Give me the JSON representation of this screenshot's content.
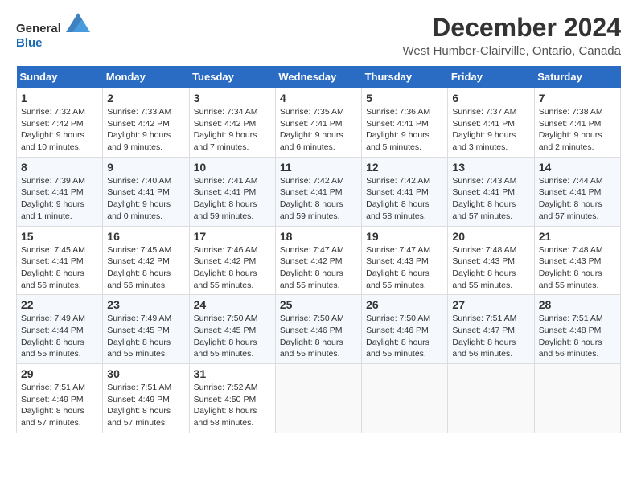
{
  "logo": {
    "general": "General",
    "blue": "Blue"
  },
  "title": "December 2024",
  "subtitle": "West Humber-Clairville, Ontario, Canada",
  "days_of_week": [
    "Sunday",
    "Monday",
    "Tuesday",
    "Wednesday",
    "Thursday",
    "Friday",
    "Saturday"
  ],
  "weeks": [
    [
      {
        "day": 1,
        "sunrise": "7:32 AM",
        "sunset": "4:42 PM",
        "daylight": "9 hours and 10 minutes."
      },
      {
        "day": 2,
        "sunrise": "7:33 AM",
        "sunset": "4:42 PM",
        "daylight": "9 hours and 9 minutes."
      },
      {
        "day": 3,
        "sunrise": "7:34 AM",
        "sunset": "4:42 PM",
        "daylight": "9 hours and 7 minutes."
      },
      {
        "day": 4,
        "sunrise": "7:35 AM",
        "sunset": "4:41 PM",
        "daylight": "9 hours and 6 minutes."
      },
      {
        "day": 5,
        "sunrise": "7:36 AM",
        "sunset": "4:41 PM",
        "daylight": "9 hours and 5 minutes."
      },
      {
        "day": 6,
        "sunrise": "7:37 AM",
        "sunset": "4:41 PM",
        "daylight": "9 hours and 3 minutes."
      },
      {
        "day": 7,
        "sunrise": "7:38 AM",
        "sunset": "4:41 PM",
        "daylight": "9 hours and 2 minutes."
      }
    ],
    [
      {
        "day": 8,
        "sunrise": "7:39 AM",
        "sunset": "4:41 PM",
        "daylight": "9 hours and 1 minute."
      },
      {
        "day": 9,
        "sunrise": "7:40 AM",
        "sunset": "4:41 PM",
        "daylight": "9 hours and 0 minutes."
      },
      {
        "day": 10,
        "sunrise": "7:41 AM",
        "sunset": "4:41 PM",
        "daylight": "8 hours and 59 minutes."
      },
      {
        "day": 11,
        "sunrise": "7:42 AM",
        "sunset": "4:41 PM",
        "daylight": "8 hours and 59 minutes."
      },
      {
        "day": 12,
        "sunrise": "7:42 AM",
        "sunset": "4:41 PM",
        "daylight": "8 hours and 58 minutes."
      },
      {
        "day": 13,
        "sunrise": "7:43 AM",
        "sunset": "4:41 PM",
        "daylight": "8 hours and 57 minutes."
      },
      {
        "day": 14,
        "sunrise": "7:44 AM",
        "sunset": "4:41 PM",
        "daylight": "8 hours and 57 minutes."
      }
    ],
    [
      {
        "day": 15,
        "sunrise": "7:45 AM",
        "sunset": "4:41 PM",
        "daylight": "8 hours and 56 minutes."
      },
      {
        "day": 16,
        "sunrise": "7:45 AM",
        "sunset": "4:42 PM",
        "daylight": "8 hours and 56 minutes."
      },
      {
        "day": 17,
        "sunrise": "7:46 AM",
        "sunset": "4:42 PM",
        "daylight": "8 hours and 55 minutes."
      },
      {
        "day": 18,
        "sunrise": "7:47 AM",
        "sunset": "4:42 PM",
        "daylight": "8 hours and 55 minutes."
      },
      {
        "day": 19,
        "sunrise": "7:47 AM",
        "sunset": "4:43 PM",
        "daylight": "8 hours and 55 minutes."
      },
      {
        "day": 20,
        "sunrise": "7:48 AM",
        "sunset": "4:43 PM",
        "daylight": "8 hours and 55 minutes."
      },
      {
        "day": 21,
        "sunrise": "7:48 AM",
        "sunset": "4:43 PM",
        "daylight": "8 hours and 55 minutes."
      }
    ],
    [
      {
        "day": 22,
        "sunrise": "7:49 AM",
        "sunset": "4:44 PM",
        "daylight": "8 hours and 55 minutes."
      },
      {
        "day": 23,
        "sunrise": "7:49 AM",
        "sunset": "4:45 PM",
        "daylight": "8 hours and 55 minutes."
      },
      {
        "day": 24,
        "sunrise": "7:50 AM",
        "sunset": "4:45 PM",
        "daylight": "8 hours and 55 minutes."
      },
      {
        "day": 25,
        "sunrise": "7:50 AM",
        "sunset": "4:46 PM",
        "daylight": "8 hours and 55 minutes."
      },
      {
        "day": 26,
        "sunrise": "7:50 AM",
        "sunset": "4:46 PM",
        "daylight": "8 hours and 55 minutes."
      },
      {
        "day": 27,
        "sunrise": "7:51 AM",
        "sunset": "4:47 PM",
        "daylight": "8 hours and 56 minutes."
      },
      {
        "day": 28,
        "sunrise": "7:51 AM",
        "sunset": "4:48 PM",
        "daylight": "8 hours and 56 minutes."
      }
    ],
    [
      {
        "day": 29,
        "sunrise": "7:51 AM",
        "sunset": "4:49 PM",
        "daylight": "8 hours and 57 minutes."
      },
      {
        "day": 30,
        "sunrise": "7:51 AM",
        "sunset": "4:49 PM",
        "daylight": "8 hours and 57 minutes."
      },
      {
        "day": 31,
        "sunrise": "7:52 AM",
        "sunset": "4:50 PM",
        "daylight": "8 hours and 58 minutes."
      },
      null,
      null,
      null,
      null
    ]
  ]
}
